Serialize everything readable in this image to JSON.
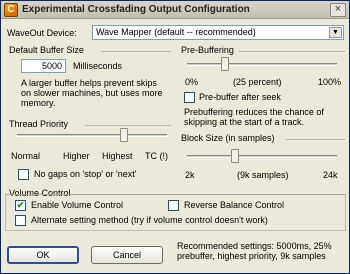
{
  "window": {
    "title": "Experimental Crossfading Output Configuration",
    "close_label": "×"
  },
  "waveout": {
    "label": "WaveOut Device:",
    "selected": "Wave Mapper (default -- recommended)"
  },
  "buffer": {
    "group_label": "Default Buffer Size",
    "value": "5000",
    "unit": "Milliseconds",
    "help": "A larger buffer helps prevent skips on slower machines, but uses more memory."
  },
  "thread_priority": {
    "group_label": "Thread Priority",
    "level": 0.71,
    "ticks": [
      "Normal",
      "Higher",
      "Highest",
      "TC (!)"
    ]
  },
  "no_gaps": {
    "label": "No gaps on 'stop' or 'next'",
    "checked": false
  },
  "prebuffering": {
    "group_label": "Pre-Buffering",
    "level": 0.25,
    "min_label": "0%",
    "mid_label": "(25 percent)",
    "max_label": "100%",
    "after_seek_label": "Pre-buffer after seek",
    "after_seek_checked": false,
    "help": "Prebuffering reduces the chance of skipping at the start of a track."
  },
  "block_size": {
    "group_label": "Block Size (in samples)",
    "level": 0.32,
    "min_label": "2k",
    "mid_label": "(9k samples)",
    "max_label": "24k"
  },
  "volume": {
    "group_label": "Volume Control",
    "enable_label": "Enable Volume Control",
    "enable_checked": true,
    "reverse_label": "Reverse Balance Control",
    "reverse_checked": false,
    "alternate_label": "Alternate setting method (try if volume control doesn't work)",
    "alternate_checked": false
  },
  "buttons": {
    "ok": "OK",
    "cancel": "Cancel"
  },
  "recommended": "Recommended settings: 5000ms, 25% prebuffer, highest priority, 9k samples",
  "colors": {
    "dialog_bg": "#ece9d8",
    "title_border": "#0a246a",
    "check_mark": "#1a8a1a"
  }
}
